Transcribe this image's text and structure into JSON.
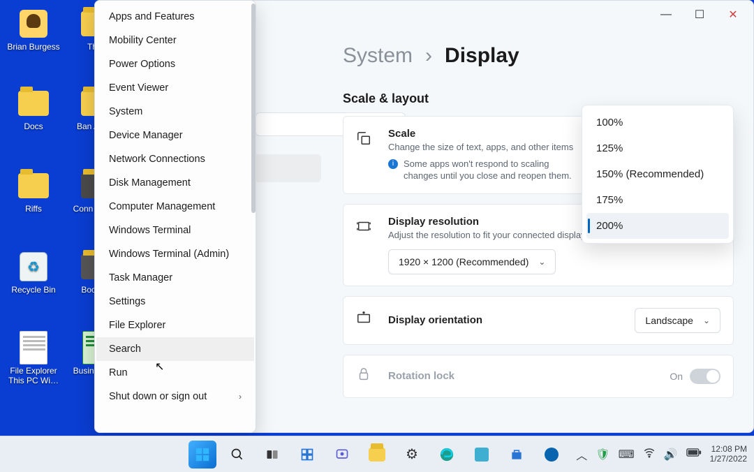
{
  "desktop": {
    "icons": [
      {
        "label": "Brian Burgess",
        "type": "user"
      },
      {
        "label": "Th…",
        "type": "folder"
      },
      {
        "label": "Docs",
        "type": "folder"
      },
      {
        "label": "Ban Ass…",
        "type": "folder"
      },
      {
        "label": "Riffs",
        "type": "folder"
      },
      {
        "label": "Conn Mes…",
        "type": "generic"
      },
      {
        "label": "Recycle Bin",
        "type": "bin"
      },
      {
        "label": "Boom…",
        "type": "generic"
      },
      {
        "label": "File Explorer This PC Wi…",
        "type": "doc"
      },
      {
        "label": "Busin Bud…",
        "type": "xl"
      }
    ]
  },
  "winx": {
    "items": [
      "Apps and Features",
      "Mobility Center",
      "Power Options",
      "Event Viewer",
      "System",
      "Device Manager",
      "Network Connections",
      "Disk Management",
      "Computer Management",
      "Windows Terminal",
      "Windows Terminal (Admin)",
      "Task Manager",
      "Settings",
      "File Explorer",
      "Search",
      "Run",
      "Shut down or sign out"
    ],
    "hover_index": 14,
    "submenu_index": 16
  },
  "settings": {
    "breadcrumb": {
      "parent": "System",
      "sep": "›",
      "current": "Display"
    },
    "section": "Scale & layout",
    "scale": {
      "title": "Scale",
      "desc": "Change the size of text, apps, and other items",
      "info": "Some apps won't respond to scaling changes until you close and reopen them.",
      "options": [
        "100%",
        "125%",
        "150% (Recommended)",
        "175%",
        "200%"
      ],
      "selected": "200%"
    },
    "resolution": {
      "title": "Display resolution",
      "desc": "Adjust the resolution to fit your connected display",
      "value": "1920 × 1200 (Recommended)"
    },
    "orientation": {
      "title": "Display orientation",
      "value": "Landscape"
    },
    "rotation": {
      "title": "Rotation lock",
      "state": "On"
    }
  },
  "titlebar": {
    "min": "—",
    "max": "☐",
    "close": "✕"
  },
  "taskbar": {
    "time": "12:08 PM",
    "date": "1/27/2022"
  }
}
